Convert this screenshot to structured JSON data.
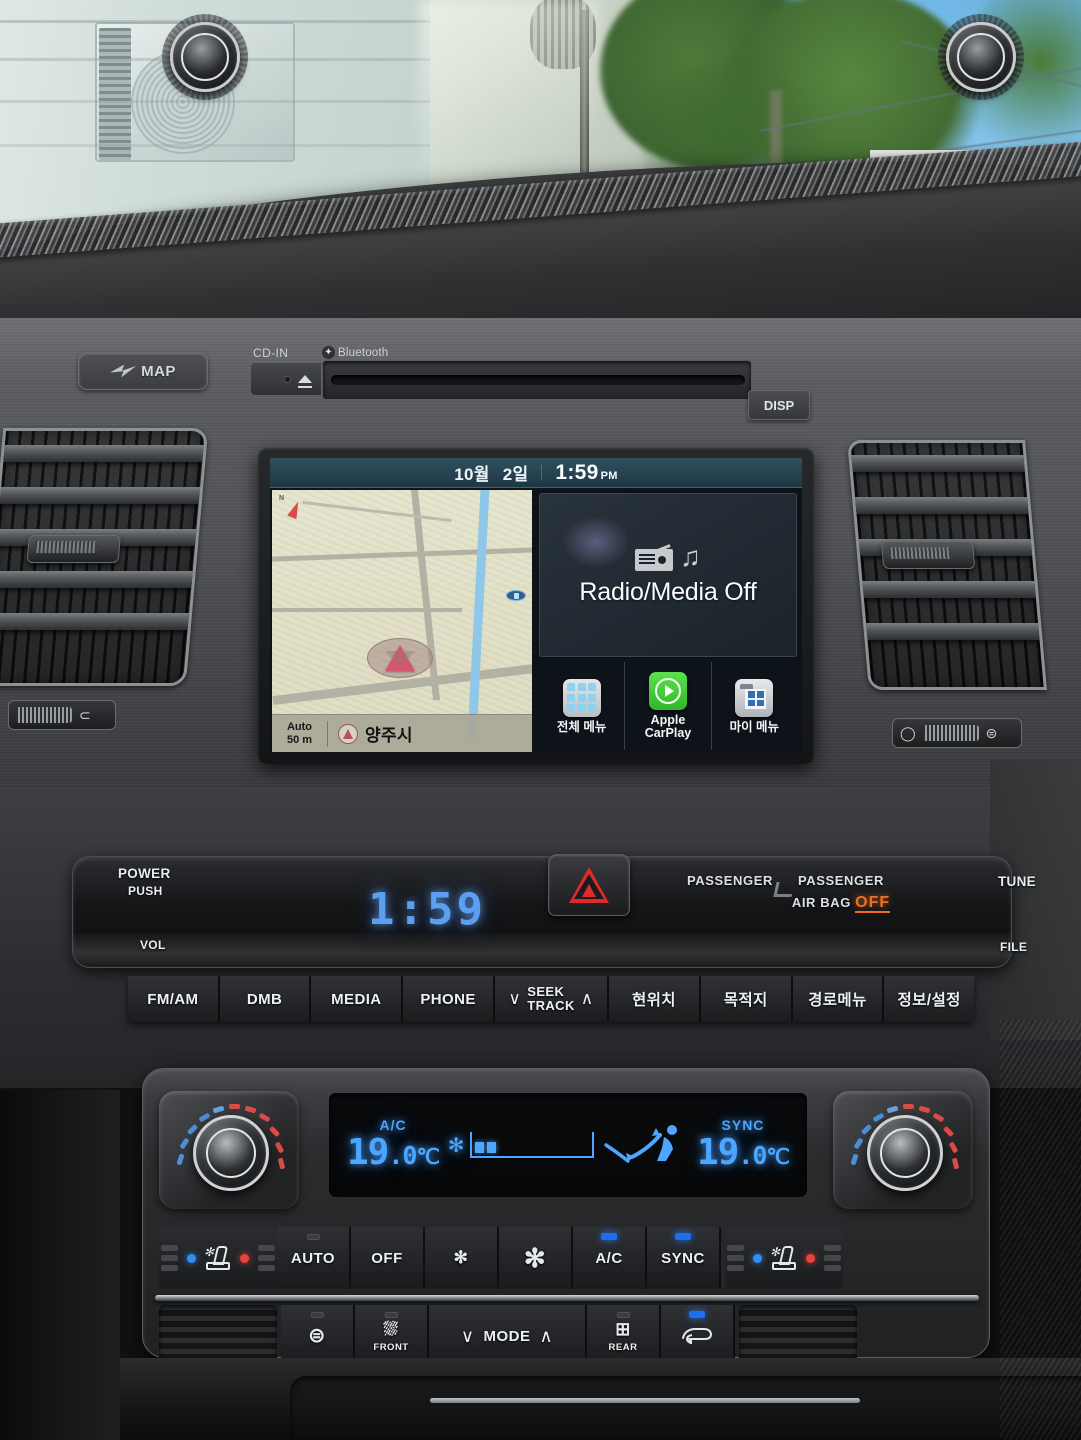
{
  "scene": {
    "description": "Hyundai Sonata center console dashboard interior photo",
    "outside": {
      "sky_color": "#6cb4e4",
      "building_color": "#cfdcd9",
      "foliage_color": "#4f7a3a"
    }
  },
  "trim_row": {
    "map_button_label": "MAP",
    "cd_in_label": "CD-IN",
    "bluetooth_label": "Bluetooth",
    "bluetooth_glyph": "bluetooth-icon",
    "disp_button_label": "DISP"
  },
  "infotainment": {
    "status_bar": {
      "month": "10월",
      "day": "2일",
      "time": "1:59",
      "ampm": "PM"
    },
    "map": {
      "compass_label": "N",
      "scale_mode": "Auto",
      "scale_distance": "50 m",
      "location_name": "양주시",
      "map_bg": "#e6e5cd",
      "river_color": "#8fc7e8",
      "road_color": "#bcbbad",
      "car_arrow_color": "#d4576b"
    },
    "media_card": {
      "title": "Radio/Media Off",
      "icons": [
        "radio-icon",
        "music-note-icon"
      ]
    },
    "applets": [
      {
        "label": "전체 메뉴",
        "icon": "grid-menu-icon",
        "color": "#8fd2ef"
      },
      {
        "label": "Apple\nCarPlay",
        "line1": "Apple",
        "line2": "CarPlay",
        "icon": "apple-carplay-icon",
        "color": "#3fc837"
      },
      {
        "label": "마이 메뉴",
        "line1": "마이 메뉴",
        "icon": "my-menu-folder-icon",
        "color": "#2f6fb5"
      }
    ]
  },
  "head_unit": {
    "left_knob": {
      "top_label": "POWER",
      "sub_label": "PUSH",
      "bottom_label": "VOL"
    },
    "right_knob": {
      "top_label": "TUNE",
      "bottom_label": "FILE"
    },
    "clock_display": "1:59",
    "clock_color": "#5c9ff0",
    "hazard_button": "hazard-triangle-icon",
    "passenger_indicator": "PASSENGER",
    "airbag": {
      "line1": "PASSENGER",
      "line2": "AIR  BAG",
      "status": "OFF",
      "status_color": "#f07020"
    }
  },
  "soft_keys": [
    {
      "label": "FM/AM",
      "name": "fm-am"
    },
    {
      "label": "DMB",
      "name": "dmb"
    },
    {
      "label": "MEDIA",
      "name": "media"
    },
    {
      "label": "PHONE",
      "name": "phone"
    },
    {
      "label": "SEEK",
      "sub": "TRACK",
      "down": "∨",
      "up": "∧",
      "name": "seek-track"
    },
    {
      "label": "현위치",
      "name": "current-position"
    },
    {
      "label": "목적지",
      "name": "destination"
    },
    {
      "label": "경로메뉴",
      "name": "route-menu"
    },
    {
      "label": "정보/설정",
      "name": "info-settings"
    }
  ],
  "climate": {
    "display": {
      "left_temp_int": "19",
      "left_temp_dec": ".0",
      "left_unit": "℃",
      "left_cap": "A/C",
      "right_temp_int": "19",
      "right_temp_dec": ".0",
      "right_unit": "℃",
      "right_cap": "SYNC",
      "fan_icon": "fan-icon",
      "fan_bars": 2,
      "mode_icon": "airflow-face-feet-icon",
      "display_color": "#4da6ff"
    },
    "row1": [
      {
        "label": "AUTO",
        "name": "auto",
        "led": "dim"
      },
      {
        "label": "OFF",
        "name": "off",
        "led": "none"
      },
      {
        "label": "",
        "icon": "fan-decrease-icon",
        "name": "fan-down",
        "led": "none"
      },
      {
        "label": "",
        "icon": "fan-increase-icon",
        "name": "fan-up",
        "led": "none"
      },
      {
        "label": "A/C",
        "name": "ac",
        "led": "on"
      },
      {
        "label": "SYNC",
        "name": "sync",
        "led": "on"
      }
    ],
    "row2": [
      {
        "label": "",
        "icon": "heated-steering-wheel-icon",
        "name": "heated-steering",
        "led": "dim"
      },
      {
        "label": "FRONT",
        "icon": "front-defrost-icon",
        "name": "front-defrost",
        "led": "dim"
      },
      {
        "label": "MODE",
        "down": "∨",
        "up": "∧",
        "name": "mode",
        "led": "none"
      },
      {
        "label": "REAR",
        "icon": "rear-defrost-icon",
        "name": "rear-defrost",
        "led": "dim"
      },
      {
        "label": "",
        "icon": "air-recirculation-icon",
        "name": "recirculation",
        "led": "on"
      }
    ],
    "seat_buttons": {
      "left": {
        "icon": "ventilated-seat-icon",
        "cool_dot": "#2f8ef5",
        "heat_dot": "#e8443a"
      },
      "right": {
        "icon": "ventilated-seat-icon",
        "cool_dot": "#2f8ef5",
        "heat_dot": "#e8443a"
      }
    },
    "temp_knobs": {
      "left_name": "driver-temperature-knob",
      "right_name": "passenger-temperature-knob",
      "cold_color": "#4f8fd6",
      "hot_color": "#d94d46"
    }
  }
}
